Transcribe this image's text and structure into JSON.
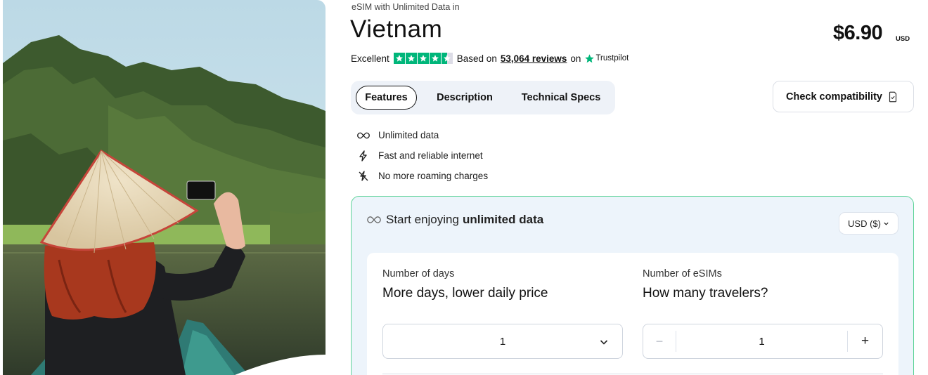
{
  "hero": {
    "image_name": "traveler-with-conical-hat-photographing-karst-mountains"
  },
  "product": {
    "eyebrow": "eSIM with Unlimited Data in",
    "title": "Vietnam",
    "price": "$6.90",
    "currency_code": "USD"
  },
  "rating": {
    "label": "Excellent",
    "stars": 4.5,
    "based_on": "Based on",
    "reviews_link": "53,064 reviews",
    "on": "on",
    "provider": "Trustpilot"
  },
  "tabs": [
    {
      "label": "Features",
      "active": true
    },
    {
      "label": "Description",
      "active": false
    },
    {
      "label": "Technical Specs",
      "active": false
    }
  ],
  "check_compatibility": "Check compatibility",
  "features": [
    {
      "icon": "infinity-icon",
      "text": "Unlimited data"
    },
    {
      "icon": "lightning-icon",
      "text": "Fast and reliable internet"
    },
    {
      "icon": "no-roaming-icon",
      "text": "No more roaming charges"
    }
  ],
  "panel": {
    "heading_prefix": "Start enjoying",
    "heading_bold": "unlimited data",
    "currency_select": "USD ($)",
    "days": {
      "label": "Number of days",
      "subtitle": "More days, lower daily price",
      "value": "1"
    },
    "esims": {
      "label": "Number of eSIMs",
      "subtitle": "How many travelers?",
      "value": "1",
      "minus": "−",
      "plus": "+"
    }
  },
  "colors": {
    "trustpilot_green": "#00b67a",
    "panel_border": "#5fd49a",
    "panel_bg": "#edf4fb",
    "tabs_bg": "#eef2f8"
  }
}
